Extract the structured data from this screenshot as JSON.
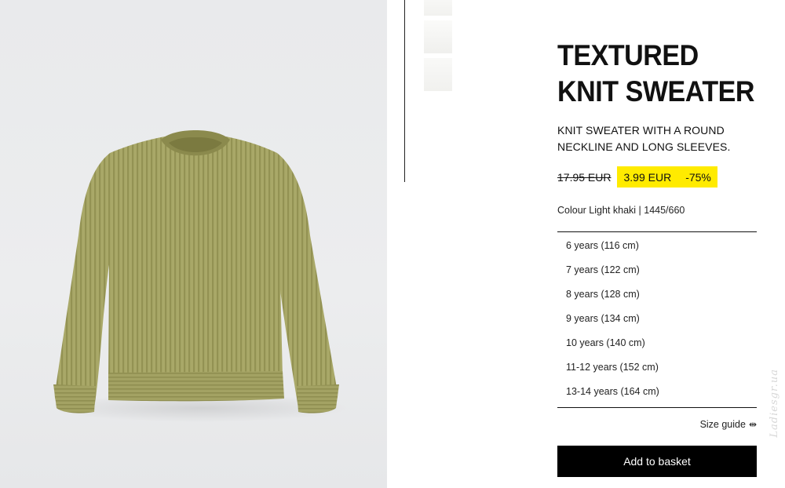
{
  "product": {
    "title": "TEXTURED KNIT SWEATER",
    "description": "KNIT SWEATER WITH A ROUND NECKLINE AND LONG SLEEVES.",
    "old_price": "17.95 EUR",
    "sale_price": "3.99 EUR",
    "discount": "-75%",
    "colour_line": "Colour Light khaki | 1445/660",
    "image_subject": "light khaki rib-knit sweater",
    "colors": {
      "sweater": "#a6a565",
      "sale_highlight": "#ffeb00"
    }
  },
  "sizes": [
    "6 years (116 cm)",
    "7 years (122 cm)",
    "8 years (128 cm)",
    "9 years (134 cm)",
    "10 years (140 cm)",
    "11-12 years (152 cm)",
    "13-14 years (164 cm)"
  ],
  "size_guide": {
    "label": "Size guide",
    "icon": "arrow-width-icon"
  },
  "actions": {
    "add_to_basket": "Add to basket"
  },
  "watermark": "Ladiesgr.ua"
}
